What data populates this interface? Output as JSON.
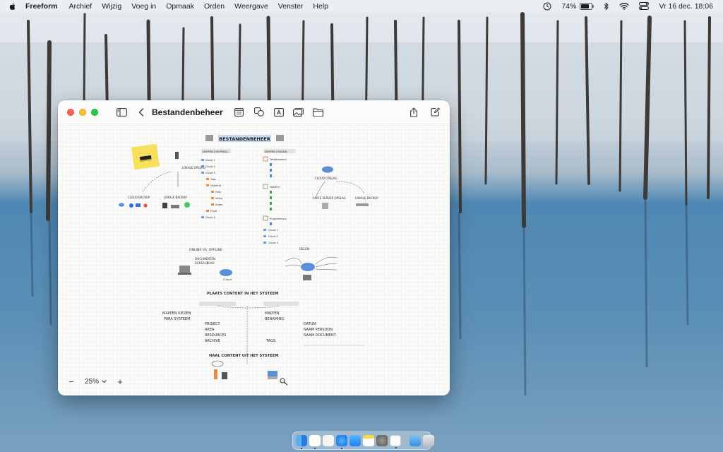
{
  "menubar": {
    "app_name": "Freeform",
    "items": [
      "Archief",
      "Wijzig",
      "Voeg in",
      "Opmaak",
      "Orden",
      "Weergave",
      "Venster",
      "Help"
    ],
    "battery": "74%",
    "datetime": "Vr 16 dec.  18:06"
  },
  "window": {
    "title": "Bestandenbeheer"
  },
  "board": {
    "title": "BESTANDENBEHEER",
    "sticky_note": "Bewerken",
    "folders_label": "MAPPEN (SHIPPING)",
    "folders_items": [
      "Cloud 1",
      "Cloud 2",
      "Cloud 3",
      "Taps",
      "Gedeeld",
      "Foto",
      "Video",
      "Ander",
      "Privé",
      "Cloud 4"
    ],
    "local_label": "LOKALE OPSLAG",
    "cloud_backup": "CLOUD BACKUP",
    "local_backup": "LOKALE BACKUP",
    "apps_label": "MAPPEN (ONLINE)",
    "apps_items": [
      "Tekstbestand",
      "Tabellen",
      "Programma's",
      "Cloud 1",
      "Cloud 2",
      "Cloud 3"
    ],
    "cloud_storage": "CLOUD OPSLAG",
    "apple_server": "APPLE SERVER OPSLAG",
    "local_backup_2": "LOKALE BACKUP",
    "online_offline": "ONLINE VS. OFFLINE",
    "docs_label": "DOCUMENTEN",
    "desktop_label": "BUREAUBLAD",
    "icloud_label": "iCloud",
    "sharing_label": "DELEN",
    "section2_title": "PLAATS CONTENT IN HET SYSTEEM",
    "section2_left": [
      "MAPPEN KIEZEN",
      "PARA SYSTEEM",
      "PROJECT",
      "AREA",
      "RESOURCES",
      "ARCHIVE"
    ],
    "section2_right": [
      "MAPPEN",
      "BENAMING",
      "DATUM",
      "NAAM PERSOON",
      "NAAM DOCUMENT",
      "TAGS"
    ],
    "section3_title": "HAAL CONTENT UIT HET SYSTEEM"
  },
  "zoom": {
    "minus": "−",
    "value": "25%",
    "plus": "+"
  },
  "colors": {
    "accent": "#007aff",
    "sticky": "#f7e15c",
    "cloud": "#5b8fd8",
    "highlight": "#e8545a"
  }
}
